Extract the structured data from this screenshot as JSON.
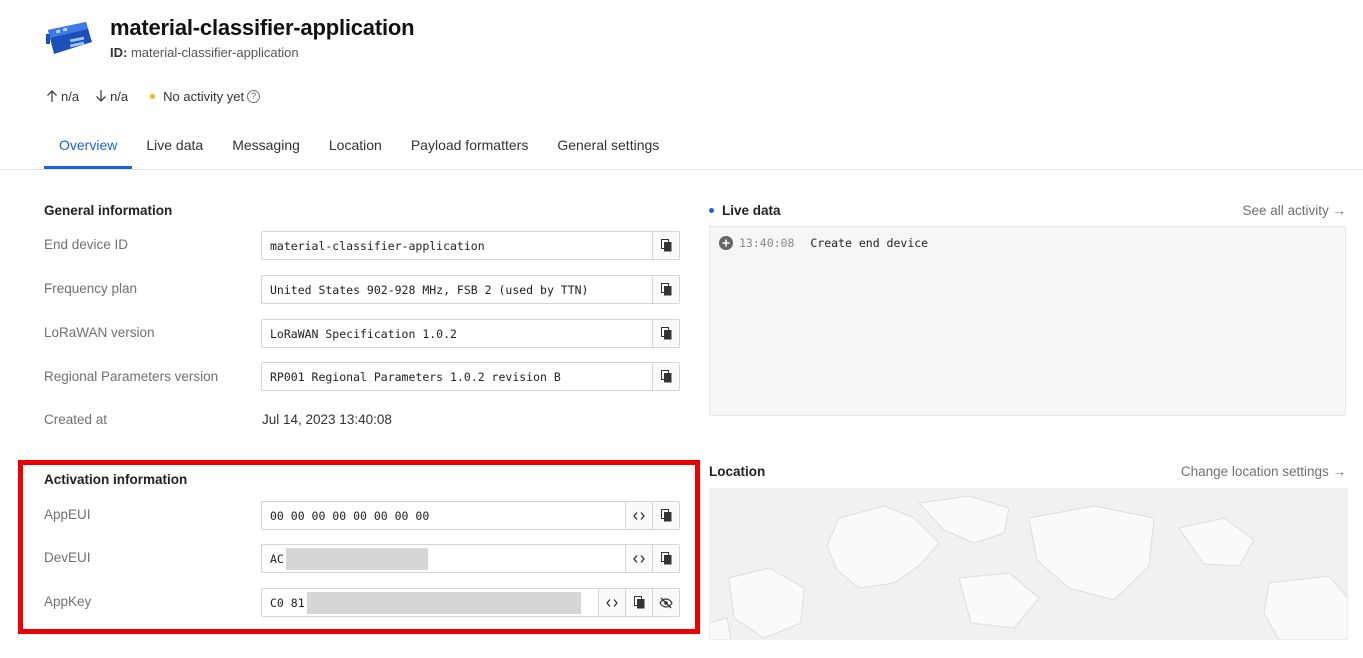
{
  "header": {
    "title": "material-classifier-application",
    "id_label": "ID:",
    "id_value": "material-classifier-application"
  },
  "stats": {
    "uplink": "n/a",
    "downlink": "n/a",
    "activity": "No activity yet",
    "activity_dot_color": "#f5b700"
  },
  "tabs": [
    {
      "label": "Overview",
      "active": true
    },
    {
      "label": "Live data"
    },
    {
      "label": "Messaging"
    },
    {
      "label": "Location"
    },
    {
      "label": "Payload formatters"
    },
    {
      "label": "General settings"
    }
  ],
  "general": {
    "title": "General information",
    "rows": [
      {
        "label": "End device ID",
        "value": "material-classifier-application"
      },
      {
        "label": "Frequency plan",
        "value": "United States 902-928 MHz, FSB 2 (used by TTN)"
      },
      {
        "label": "LoRaWAN version",
        "value": "LoRaWAN Specification 1.0.2"
      },
      {
        "label": "Regional Parameters version",
        "value": "RP001 Regional Parameters 1.0.2 revision B"
      }
    ],
    "created_label": "Created at",
    "created_value": "Jul 14, 2023 13:40:08"
  },
  "activation": {
    "title": "Activation information",
    "rows": [
      {
        "label": "AppEUI",
        "value": "00 00 00 00 00 00 00 00"
      },
      {
        "label": "DevEUI",
        "value": "AC"
      },
      {
        "label": "AppKey",
        "value": "C0 81"
      }
    ]
  },
  "live": {
    "title": "Live data",
    "see_all": "See all activity →",
    "events": [
      {
        "time": "13:40:08",
        "message": "Create end device"
      }
    ]
  },
  "location": {
    "title": "Location",
    "link": "Change location settings →"
  },
  "colors": {
    "accent": "#1d62e8",
    "highlight": "#ee0000"
  }
}
